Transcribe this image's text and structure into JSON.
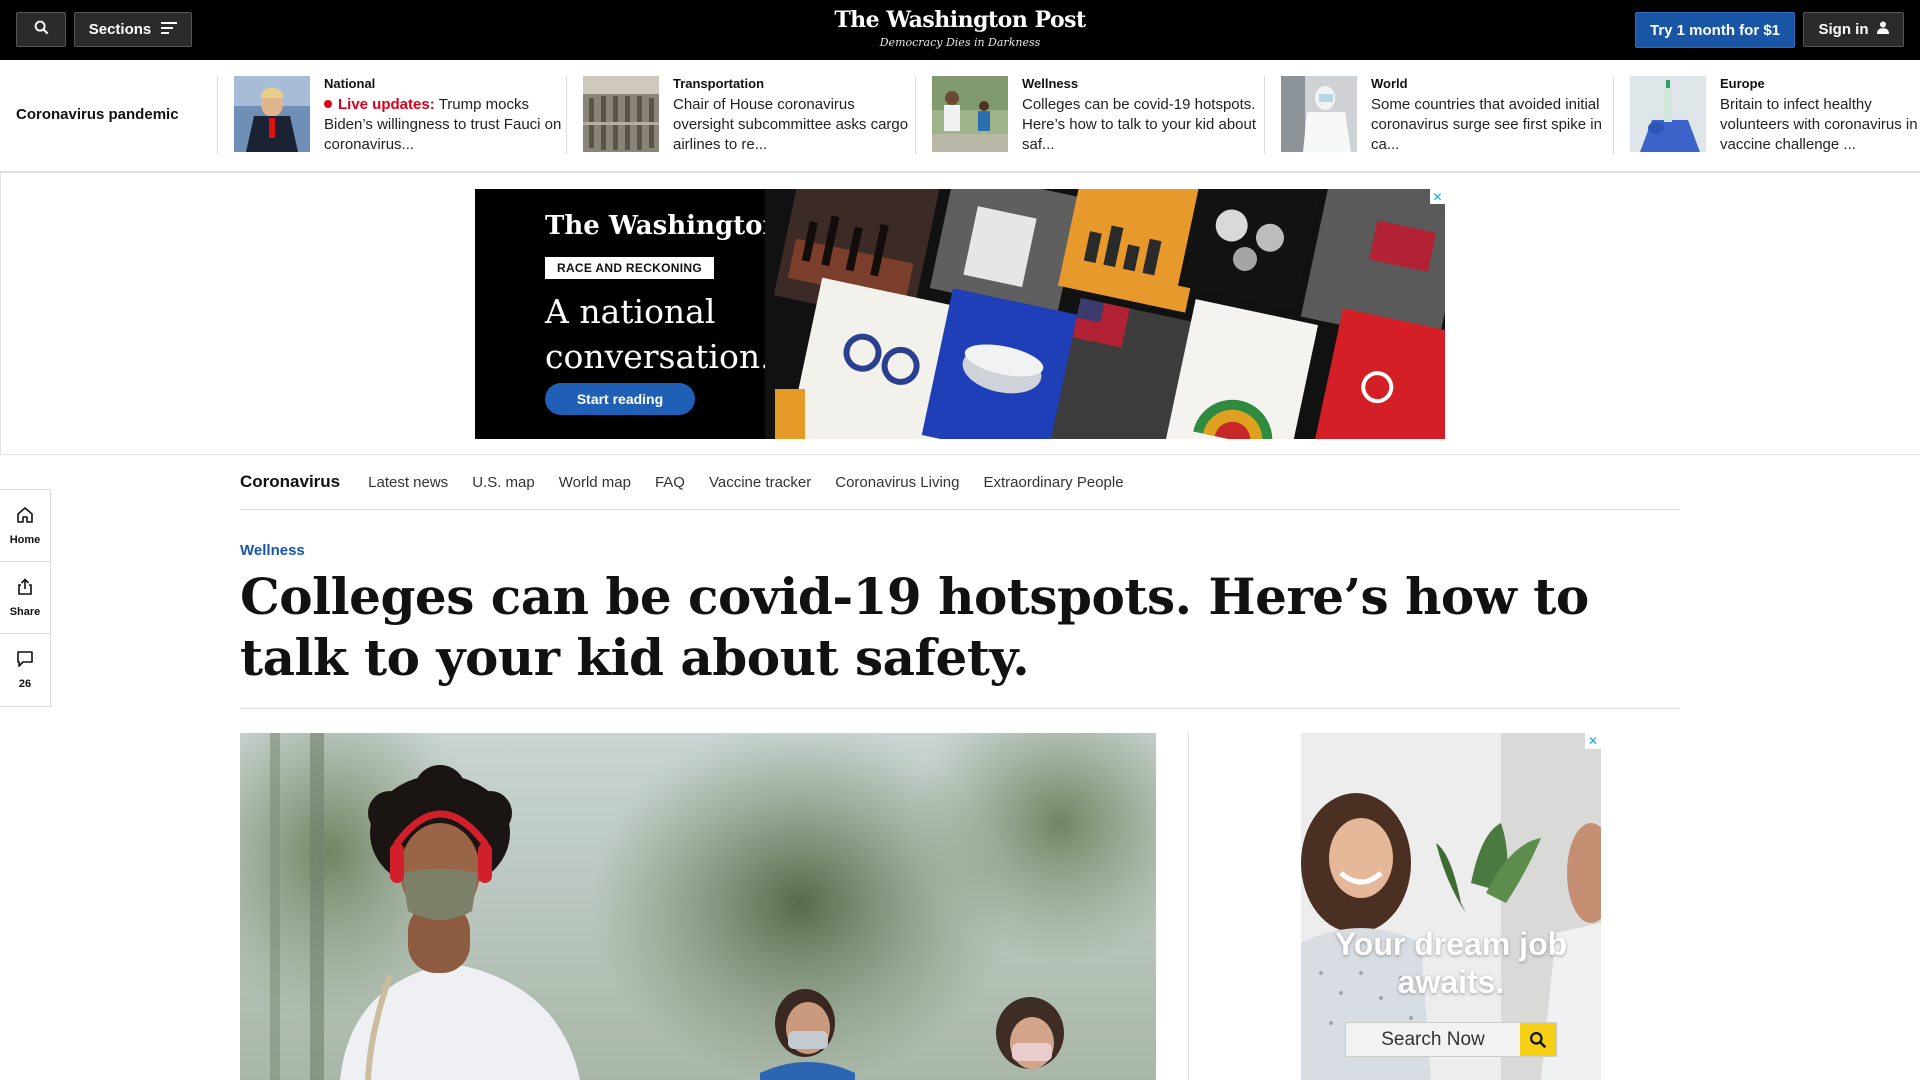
{
  "header": {
    "sections_label": "Sections",
    "logo": "The Washington Post",
    "tagline": "Democracy Dies in Darkness",
    "subscribe_label": "Try 1 month for $1",
    "signin_label": "Sign in"
  },
  "ticker": {
    "title": "Coronavirus pandemic",
    "items": [
      {
        "kicker": "National",
        "live_label": "Live updates:",
        "headline": "Trump mocks Biden’s willingness to trust Fauci on coronavirus..."
      },
      {
        "kicker": "Transportation",
        "headline": "Chair of House coronavirus oversight subcommittee asks cargo airlines to re..."
      },
      {
        "kicker": "Wellness",
        "headline": "Colleges can be covid-19 hotspots. Here’s how to talk to your kid about saf..."
      },
      {
        "kicker": "World",
        "headline": "Some countries that avoided initial coronavirus surge see first spike in ca..."
      },
      {
        "kicker": "Europe",
        "headline": "Britain to infect healthy volunteers with coronavirus in vaccine challenge ..."
      }
    ]
  },
  "top_ad": {
    "logo": "The Washington Post",
    "tag": "RACE AND RECKONING",
    "headline": "A national conversation.",
    "cta": "Start reading",
    "close": "✕"
  },
  "rail": {
    "home": "Home",
    "share": "Share",
    "comments_count": "26"
  },
  "section_nav": {
    "title": "Coronavirus",
    "links": [
      "Latest news",
      "U.S. map",
      "World map",
      "FAQ",
      "Vaccine tracker",
      "Coronavirus Living",
      "Extraordinary People"
    ]
  },
  "article": {
    "kicker": "Wellness",
    "headline": "Colleges can be covid-19 hotspots. Here’s how to talk to your kid about safety."
  },
  "side_ad": {
    "headline": "Your dream job awaits.",
    "search_label": "Search Now",
    "close": "✕"
  },
  "colors": {
    "header_bg": "#000000",
    "brand_blue": "#1955a5",
    "live_red": "#d9001b",
    "ad_cta_blue": "#1f5fb5",
    "search_yellow": "#f4cf14"
  }
}
